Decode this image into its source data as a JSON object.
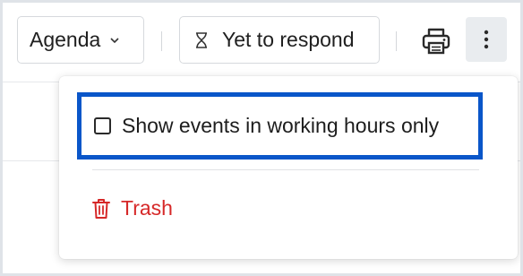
{
  "toolbar": {
    "view_label": "Agenda",
    "filter_label": "Yet to respond",
    "print_icon": "printer-icon",
    "more_icon": "kebab-menu-icon"
  },
  "menu": {
    "option_label": "Show events in working hours only",
    "option_checked": false,
    "trash_label": "Trash",
    "trash_icon": "trash-icon"
  },
  "colors": {
    "highlight": "#0a56c9",
    "danger": "#d62828",
    "more_bg": "#e9ecef"
  }
}
